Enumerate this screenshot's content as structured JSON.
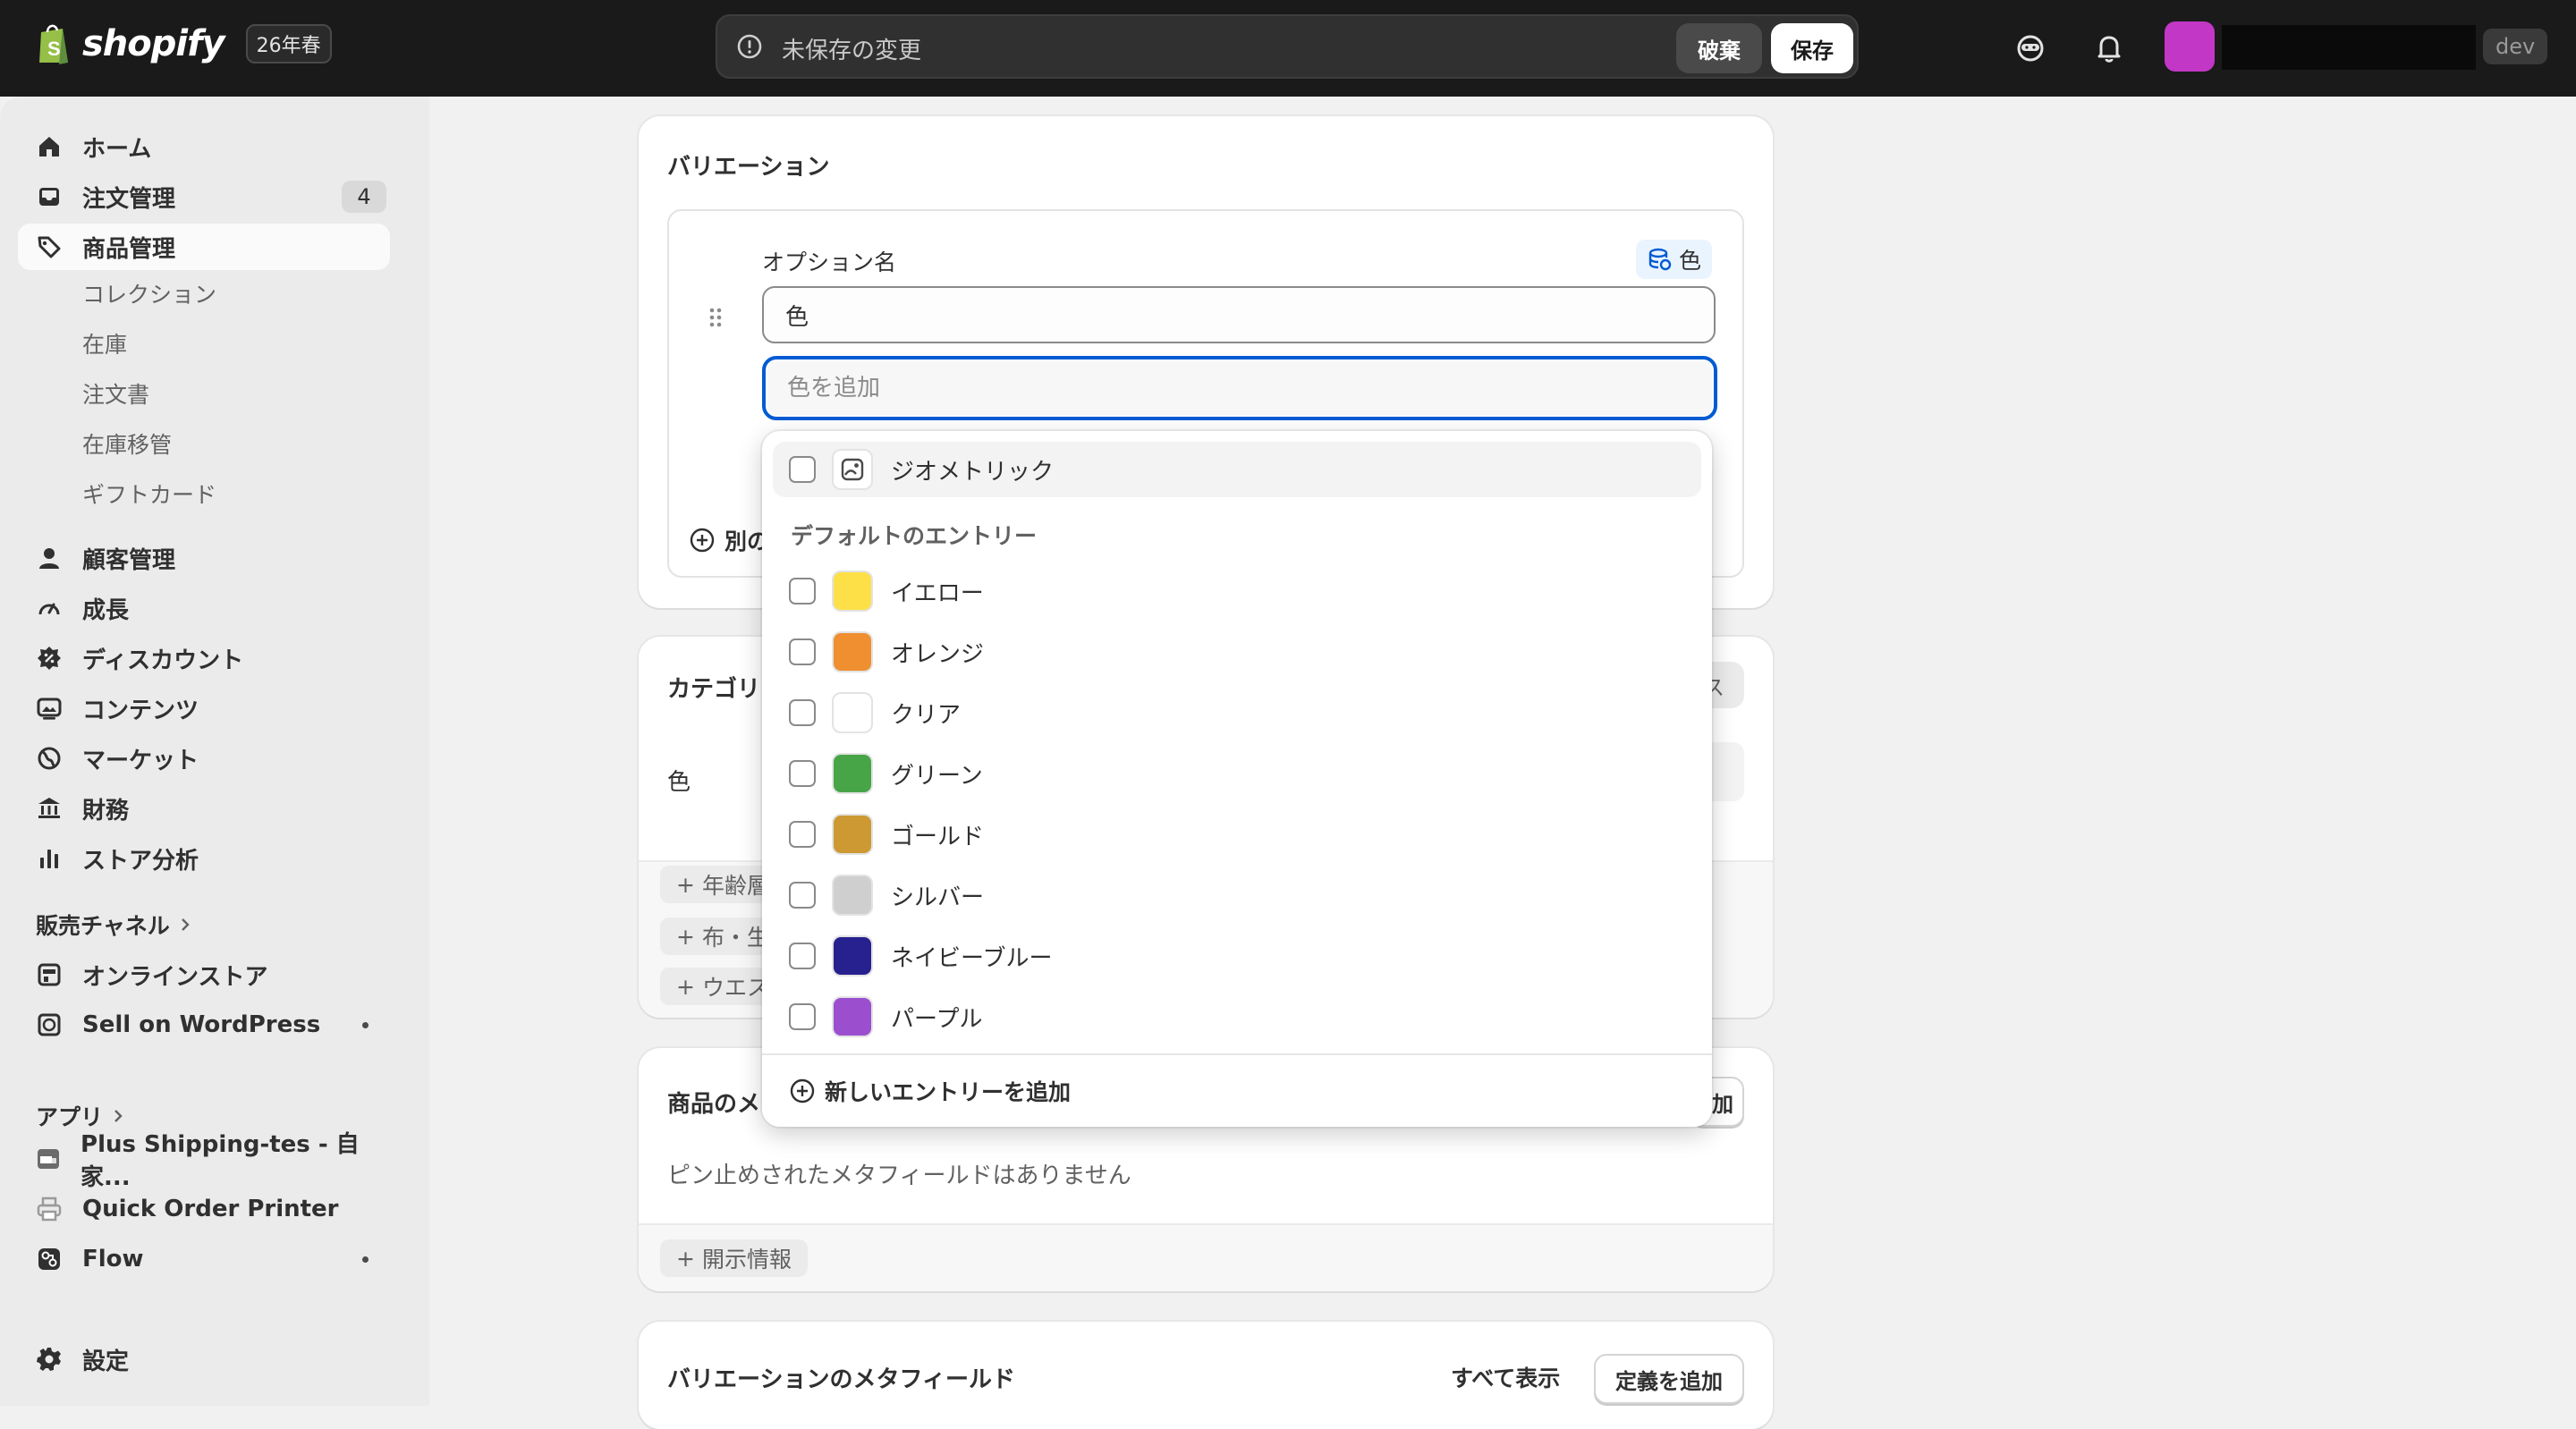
{
  "topbar": {
    "brand": "shopify",
    "edition": "26年春",
    "unsaved_message": "未保存の変更",
    "discard_label": "破棄",
    "save_label": "保存",
    "dev_label": "dev"
  },
  "sidebar": {
    "home": "ホーム",
    "orders": "注文管理",
    "orders_count": "4",
    "products": "商品管理",
    "products_sub": [
      "コレクション",
      "在庫",
      "注文書",
      "在庫移管",
      "ギフトカード"
    ],
    "customers": "顧客管理",
    "growth": "成長",
    "discounts": "ディスカウント",
    "content": "コンテンツ",
    "markets": "マーケット",
    "finance": "財務",
    "analytics": "ストア分析",
    "sales_channels": "販売チャネル",
    "online_store": "オンラインストア",
    "sell_on_wordpress": "Sell on WordPress",
    "apps": "アプリ",
    "app_plus_shipping": "Plus Shipping-tes - 自家...",
    "app_quick_order": "Quick Order Printer",
    "app_flow": "Flow",
    "settings": "設定"
  },
  "variants_card": {
    "title": "バリエーション",
    "option_name_label": "オプション名",
    "metafield_chip": "色",
    "option_name_value": "色",
    "option_value_placeholder": "色を追加",
    "add_option": "別の"
  },
  "category_card": {
    "title": "カテゴリ",
    "right_partial": "ス",
    "row_label": "色",
    "pills": [
      "年齢層",
      "布・生",
      "ウエス"
    ]
  },
  "metafields_card": {
    "title": "商品のメ",
    "right_button_partial": "加",
    "empty_text": "ピン止めされたメタフィールドはありません",
    "disclosure_pill": "開示情報"
  },
  "variant_metafields_card": {
    "title": "バリエーションのメタフィールド",
    "show_all": "すべて表示",
    "add_definition": "定義を追加"
  },
  "dropdown": {
    "top_item": "ジオメトリック",
    "section_title": "デフォルトのエントリー",
    "entries": [
      {
        "label": "イエロー",
        "color": "#fde047"
      },
      {
        "label": "オレンジ",
        "color": "#ef8f30"
      },
      {
        "label": "クリア",
        "color": "#ffffff"
      },
      {
        "label": "グリーン",
        "color": "#47a547"
      },
      {
        "label": "ゴールド",
        "color": "#cc9933"
      },
      {
        "label": "シルバー",
        "color": "#cfcfcf"
      },
      {
        "label": "ネイビーブルー",
        "color": "#27208f"
      },
      {
        "label": "パープル",
        "color": "#9b4fcf"
      }
    ],
    "add_new_entry": "新しいエントリーを追加"
  },
  "colors": {
    "accent_focus": "#005bd3",
    "avatar": "#c237c5",
    "topbar": "#1a1a1a"
  }
}
